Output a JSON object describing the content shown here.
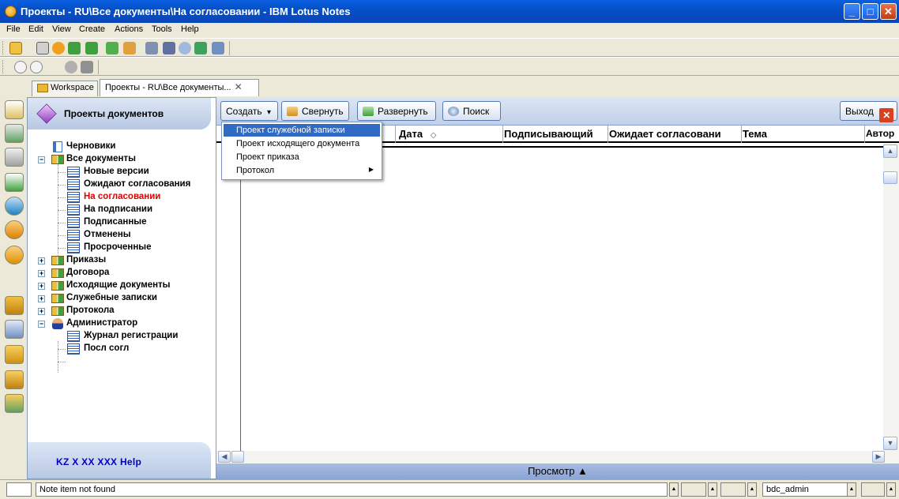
{
  "window": {
    "title": "Проекты - RU\\Все документы\\На согласовании - IBM Lotus Notes",
    "minimize": "_",
    "maximize": "□",
    "close": "✕"
  },
  "menu": [
    "File",
    "Edit",
    "View",
    "Create",
    "Actions",
    "Tools",
    "Help"
  ],
  "tabs": [
    {
      "label": "Workspace"
    },
    {
      "label": "Проекты - RU\\Все документы...",
      "close": "✕"
    }
  ],
  "outline": {
    "title": "Проекты документов",
    "items": [
      {
        "label": "Черновики",
        "level": 0,
        "icon": "page-icon",
        "expander": ""
      },
      {
        "label": "Все документы",
        "level": 0,
        "icon": "book-icon",
        "expander": "−"
      },
      {
        "label": "Новые версии",
        "level": 1,
        "icon": "view-icon"
      },
      {
        "label": "Ожидают согласования",
        "level": 1,
        "icon": "view-icon"
      },
      {
        "label": "На согласовании",
        "level": 1,
        "icon": "view-icon",
        "selected": true
      },
      {
        "label": "На подписании",
        "level": 1,
        "icon": "view-icon"
      },
      {
        "label": "Подписанные",
        "level": 1,
        "icon": "view-icon"
      },
      {
        "label": "Отменены",
        "level": 1,
        "icon": "view-icon"
      },
      {
        "label": "Просроченные",
        "level": 1,
        "icon": "view-icon"
      },
      {
        "label": "Приказы",
        "level": 0,
        "icon": "book-icon",
        "expander": "+"
      },
      {
        "label": "Договора",
        "level": 0,
        "icon": "book-icon",
        "expander": "+"
      },
      {
        "label": "Исходящие документы",
        "level": 0,
        "icon": "book-icon",
        "expander": "+"
      },
      {
        "label": "Служебные записки",
        "level": 0,
        "icon": "book-icon",
        "expander": "+"
      },
      {
        "label": "Протокола",
        "level": 0,
        "icon": "book-icon",
        "expander": "+"
      },
      {
        "label": "Администратор",
        "level": 0,
        "icon": "user-icon",
        "expander": "−"
      },
      {
        "label": "Журнал регистрации",
        "level": 1,
        "icon": "view-icon"
      },
      {
        "label": "Посл согл",
        "level": 1,
        "icon": "view-icon"
      }
    ],
    "footer_links": "KZ  X  XX  XXX  Help",
    "selected_color": "#e00000"
  },
  "actions": {
    "create": "Создать",
    "create_arrow": "▾",
    "collapse": "Свернуть",
    "expand": "Развернуть",
    "search": "Поиск",
    "exit": "Выход",
    "exit_icon": "✕"
  },
  "columns": [
    "Дата",
    "Подписывающий",
    "Ожидает согласовани",
    "Тема",
    "Автор"
  ],
  "sort_indicator": "◇",
  "create_menu": [
    {
      "label": "Проект служебной записки",
      "selected": true
    },
    {
      "label": "Проект исходящего документа"
    },
    {
      "label": "Проект приказа"
    },
    {
      "label": "Протокол",
      "submenu": "▶"
    }
  ],
  "view_bar": "Просмотр ▲",
  "status": {
    "message": "Note item not found",
    "user": "bdc_admin",
    "arrow": "▲"
  },
  "scroll": {
    "up": "▲",
    "down": "▼",
    "left": "◀",
    "right": "▶"
  }
}
